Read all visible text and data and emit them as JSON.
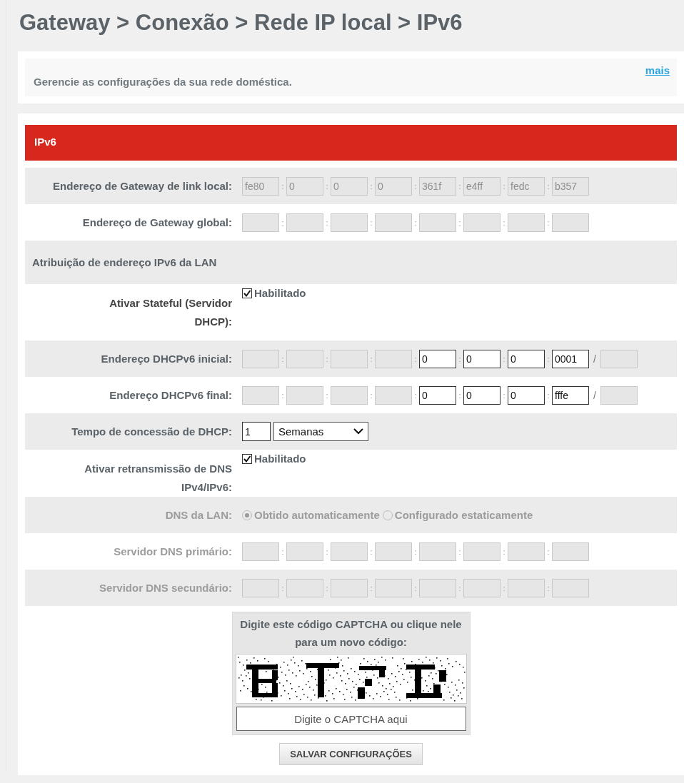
{
  "breadcrumb": "Gateway > Conexão > Rede IP local > IPv6",
  "description": {
    "text": "Gerencie as configurações da sua rede doméstica.",
    "link": "mais"
  },
  "panel": {
    "title": "IPv6",
    "separator": ":",
    "prefix_separator": "/",
    "rows": [
      {
        "kind": "address",
        "label": "Endereço de Gateway de link local:",
        "disabled": false,
        "fields": [
          {
            "value": "fe80",
            "disabled": true
          },
          {
            "value": "0",
            "disabled": true
          },
          {
            "value": "0",
            "disabled": true
          },
          {
            "value": "0",
            "disabled": true
          },
          {
            "value": "361f",
            "disabled": true
          },
          {
            "value": "e4ff",
            "disabled": true
          },
          {
            "value": "fedc",
            "disabled": true
          },
          {
            "value": "b357",
            "disabled": true
          }
        ]
      },
      {
        "kind": "address",
        "label": "Endereço de Gateway global:",
        "disabled": false,
        "fields": [
          {
            "disabled": true
          },
          {
            "disabled": true
          },
          {
            "disabled": true
          },
          {
            "disabled": true
          },
          {
            "disabled": true
          },
          {
            "disabled": true
          },
          {
            "disabled": true
          },
          {
            "disabled": true
          }
        ]
      },
      {
        "kind": "section",
        "label": "Atribuição de endereço IPv6 da LAN"
      },
      {
        "kind": "checkbox",
        "label": "Ativar Stateful (Servidor DHCP):",
        "disabled": false,
        "option": "Habilitado",
        "checked": true
      },
      {
        "kind": "address",
        "label": "Endereço DHCPv6 inicial:",
        "disabled": false,
        "fields": [
          {
            "disabled": true
          },
          {
            "disabled": true
          },
          {
            "disabled": true
          },
          {
            "disabled": true
          },
          {
            "value": "0",
            "disabled": false
          },
          {
            "value": "0",
            "disabled": false
          },
          {
            "value": "0",
            "disabled": false
          },
          {
            "value": "0001",
            "disabled": false
          }
        ],
        "prefix": {
          "disabled": true
        }
      },
      {
        "kind": "address",
        "label": "Endereço DHCPv6 final:",
        "disabled": false,
        "fields": [
          {
            "disabled": true
          },
          {
            "disabled": true
          },
          {
            "disabled": true
          },
          {
            "disabled": true
          },
          {
            "value": "0",
            "disabled": false
          },
          {
            "value": "0",
            "disabled": false
          },
          {
            "value": "0",
            "disabled": false
          },
          {
            "value": "fffe",
            "disabled": false
          }
        ],
        "prefix": {
          "disabled": true
        }
      },
      {
        "kind": "lease",
        "label": "Tempo de concessão de DHCP:",
        "disabled": false,
        "value": "1",
        "unit": "Semanas"
      },
      {
        "kind": "checkbox",
        "label": "Ativar retransmissão de DNS IPv4/IPv6:",
        "disabled": false,
        "option": "Habilitado",
        "checked": true
      },
      {
        "kind": "radio",
        "label": "DNS da LAN:",
        "disabled": true,
        "options": [
          {
            "label": "Obtido automaticamente",
            "selected": true
          },
          {
            "label": "Configurado estaticamente",
            "selected": false
          }
        ]
      },
      {
        "kind": "address",
        "label": "Servidor DNS primário:",
        "disabled": true,
        "fields": [
          {
            "disabled": true
          },
          {
            "disabled": true
          },
          {
            "disabled": true
          },
          {
            "disabled": true
          },
          {
            "disabled": true
          },
          {
            "disabled": true
          },
          {
            "disabled": true
          },
          {
            "disabled": true
          }
        ]
      },
      {
        "kind": "address",
        "label": "Servidor DNS secundário:",
        "disabled": true,
        "fields": [
          {
            "disabled": true
          },
          {
            "disabled": true
          },
          {
            "disabled": true
          },
          {
            "disabled": true
          },
          {
            "disabled": true
          },
          {
            "disabled": true
          },
          {
            "disabled": true
          },
          {
            "disabled": true
          }
        ]
      }
    ]
  },
  "captcha": {
    "prompt": "Digite este código CAPTCHA ou clique nele para um novo código:",
    "placeholder": "Digite o CAPTCHA aqui"
  },
  "save_button": "SALVAR CONFIGURAÇÕES"
}
